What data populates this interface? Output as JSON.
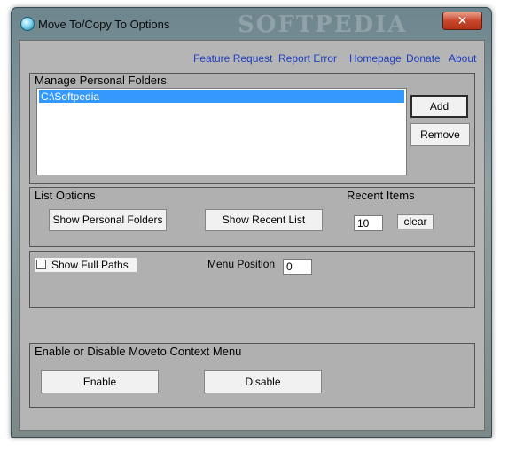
{
  "window": {
    "title": "Move To/Copy To Options",
    "watermark": "SOFTPEDIA",
    "close_glyph": "✕"
  },
  "links": [
    "Feature Request",
    "Report Error",
    "Homepage",
    "Donate",
    "About"
  ],
  "personal_folders": {
    "label": "Manage Personal Folders",
    "items": [
      "C:\\Softpedia"
    ],
    "add_label": "Add",
    "remove_label": "Remove"
  },
  "list_options": {
    "label": "List Options",
    "show_personal_label": "Show Personal Folders",
    "show_recent_label": "Show Recent List",
    "recent_items_label": "Recent Items",
    "recent_items_value": "10",
    "clear_label": "clear"
  },
  "paths": {
    "show_full_paths_label": "Show Full Paths",
    "show_full_paths_checked": false,
    "menu_position_label": "Menu Position",
    "menu_position_value": "0"
  },
  "context_menu": {
    "label": "Enable or Disable Moveto Context Menu",
    "enable_label": "Enable",
    "disable_label": "Disable"
  }
}
